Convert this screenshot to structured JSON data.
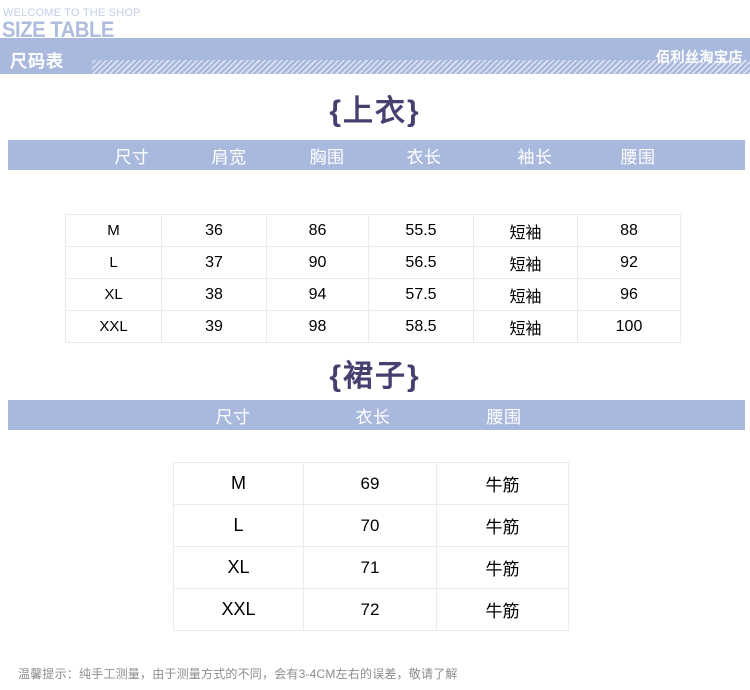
{
  "header": {
    "welcome": "WELCOME TO THE SHOP",
    "size_table_en": "SIZE TABLE",
    "banner_title": "尺码表",
    "shop_name": "佰利丝淘宝店"
  },
  "colors": {
    "banner_bg": "#a9b9dd",
    "title_purple": "#493e70",
    "en_blue": "#aebdde",
    "welcome_blue": "#c3cee8",
    "cell_border": "#ebebeb",
    "footer_gray": "#8c8c8c"
  },
  "sections": [
    {
      "title": "{上衣}",
      "headers": [
        "尺寸",
        "肩宽",
        "胸围",
        "衣长",
        "袖长",
        "腰围"
      ],
      "rows": [
        [
          "M",
          "36",
          "86",
          "55.5",
          "短袖",
          "88"
        ],
        [
          "L",
          "37",
          "90",
          "56.5",
          "短袖",
          "92"
        ],
        [
          "XL",
          "38",
          "94",
          "57.5",
          "短袖",
          "96"
        ],
        [
          "XXL",
          "39",
          "98",
          "58.5",
          "短袖",
          "100"
        ]
      ]
    },
    {
      "title": "{裙子}",
      "headers": [
        "尺寸",
        "衣长",
        "腰围"
      ],
      "rows": [
        [
          "M",
          "69",
          "牛筋"
        ],
        [
          "L",
          "70",
          "牛筋"
        ],
        [
          "XL",
          "71",
          "牛筋"
        ],
        [
          "XXL",
          "72",
          "牛筋"
        ]
      ]
    }
  ],
  "footer": {
    "note": "温馨提示：纯手工测量，由于测量方式的不同，会有3-4CM左右的误差，敬请了解"
  }
}
